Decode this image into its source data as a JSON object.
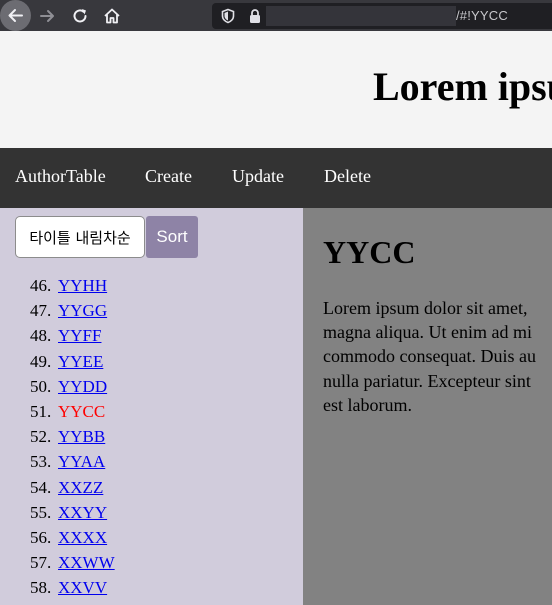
{
  "browser": {
    "url_suffix": "/#!YYCC"
  },
  "site": {
    "title": "Lorem ipsum"
  },
  "nav": {
    "items": [
      "AuthorTable",
      "Create",
      "Update",
      "Delete"
    ]
  },
  "sidebar": {
    "sort_order": "타이틀 내림차순",
    "sort_button": "Sort",
    "items": [
      {
        "num": "46.",
        "label": "YYHH"
      },
      {
        "num": "47.",
        "label": "YYGG"
      },
      {
        "num": "48.",
        "label": "YYFF"
      },
      {
        "num": "49.",
        "label": "YYEE"
      },
      {
        "num": "50.",
        "label": "YYDD"
      },
      {
        "num": "51.",
        "label": "YYCC"
      },
      {
        "num": "52.",
        "label": "YYBB"
      },
      {
        "num": "53.",
        "label": "YYAA"
      },
      {
        "num": "54.",
        "label": "XXZZ"
      },
      {
        "num": "55.",
        "label": "XXYY"
      },
      {
        "num": "56.",
        "label": "XXXX"
      },
      {
        "num": "57.",
        "label": "XXWW"
      },
      {
        "num": "58.",
        "label": "XXVV"
      }
    ],
    "active_label": "YYCC"
  },
  "main": {
    "title": "YYCC",
    "body_lines": [
      "Lorem ipsum dolor sit amet,",
      "magna aliqua. Ut enim ad mi",
      "commodo consequat. Duis au",
      "nulla pariatur. Excepteur sint",
      "est laborum."
    ]
  },
  "colors": {
    "active_item": "#ff0000",
    "link": "#0000ee",
    "sidebar_bg": "#d1ccdc",
    "main_bg": "#828282",
    "nav_bg": "#333333",
    "sort_button_bg": "#8e83a6"
  },
  "icons": [
    "back-arrow-icon",
    "forward-arrow-icon",
    "reload-icon",
    "home-icon",
    "shield-icon",
    "lock-icon"
  ]
}
